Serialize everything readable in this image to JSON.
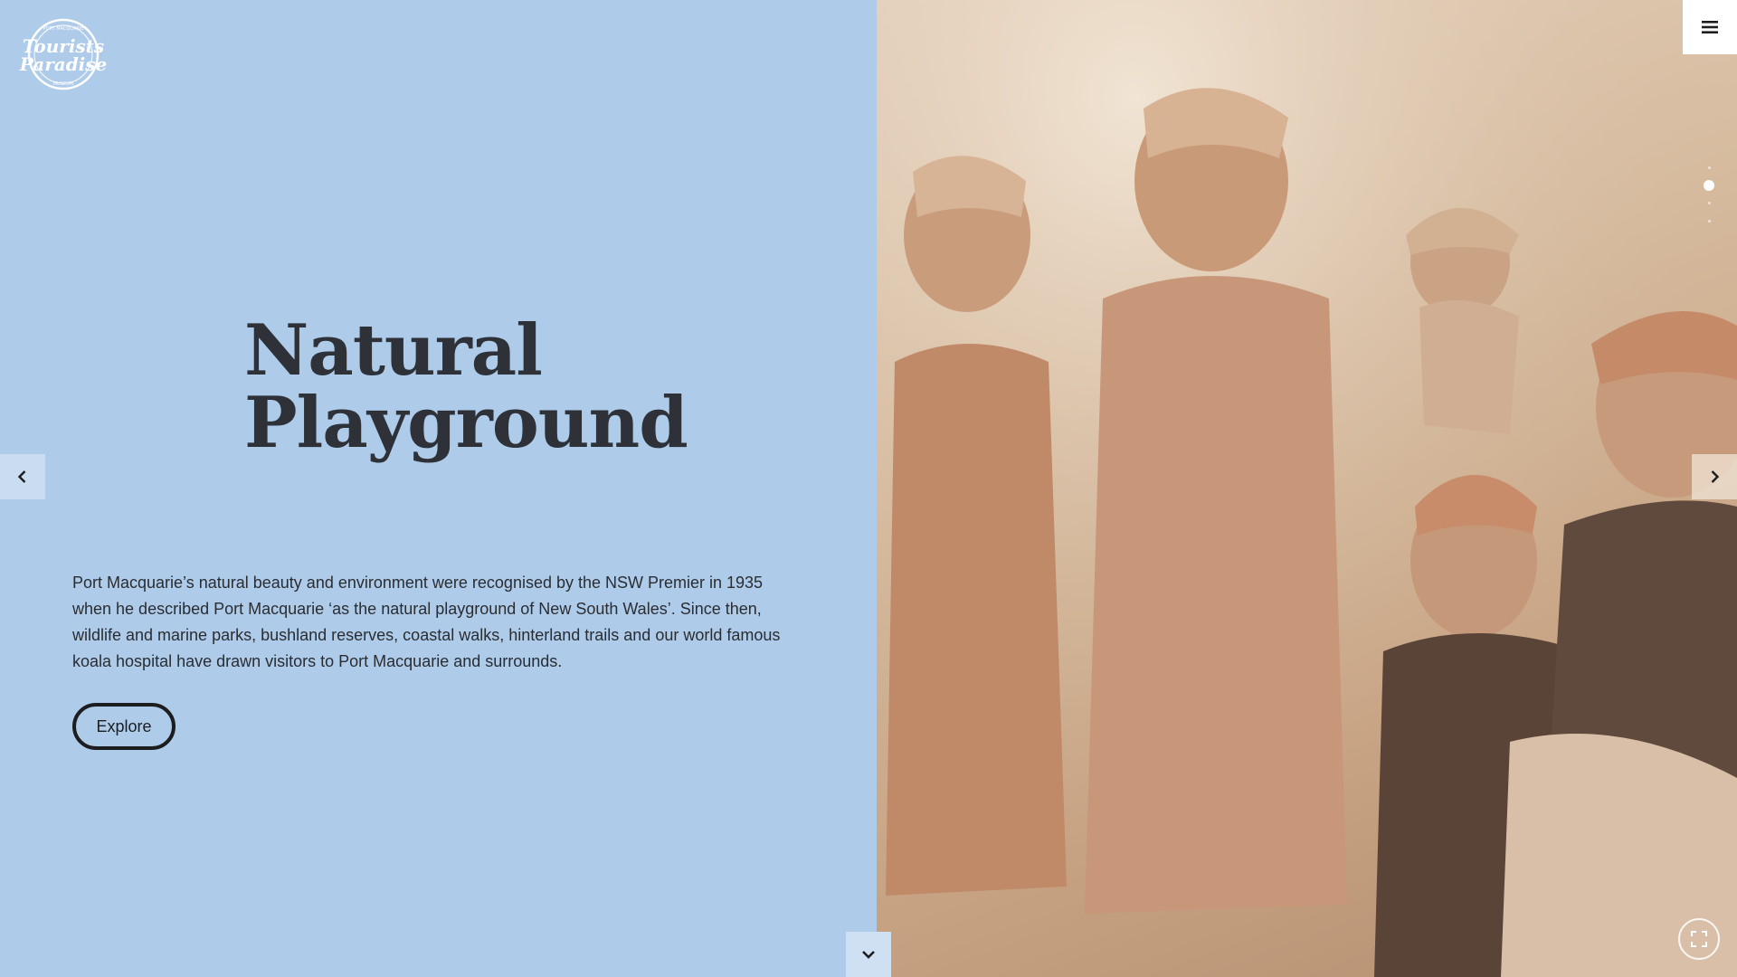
{
  "logo": {
    "text_top": "Tourists",
    "text_bottom": "Paradise",
    "ring_text_top": "PORT MACQUARIE",
    "ring_text_bottom": "MUSEUM",
    "icon": "logo-badge"
  },
  "hero": {
    "title_line1": "Natural",
    "title_line2": "Playground",
    "description": "Port Macquarie’s natural beauty and environment were recognised by the NSW Premier in 1935 when he described Port Macquarie ‘as the natural playground of New South Wales’. Since then, wildlife and marine parks, bushland reserves, coastal walks, hinterland trails and our world famous koala hospital have drawn visitors to Port Macquarie and surrounds.",
    "cta_label": "Explore"
  },
  "photo": {
    "subject": "vintage-sepia-beach-swimmers",
    "tint": "#c9a888"
  },
  "nav": {
    "prev_icon": "chevron-left-icon",
    "next_icon": "chevron-right-icon",
    "scroll_icon": "chevron-down-icon",
    "menu_icon": "hamburger-menu-icon",
    "fullscreen_icon": "fullscreen-expand-icon"
  },
  "slides": {
    "count": 4,
    "active": 1
  },
  "colors": {
    "left_panel": "#aecbea",
    "title": "#2e3238",
    "text": "#2a2d31",
    "button_border": "#1c1d1f"
  }
}
